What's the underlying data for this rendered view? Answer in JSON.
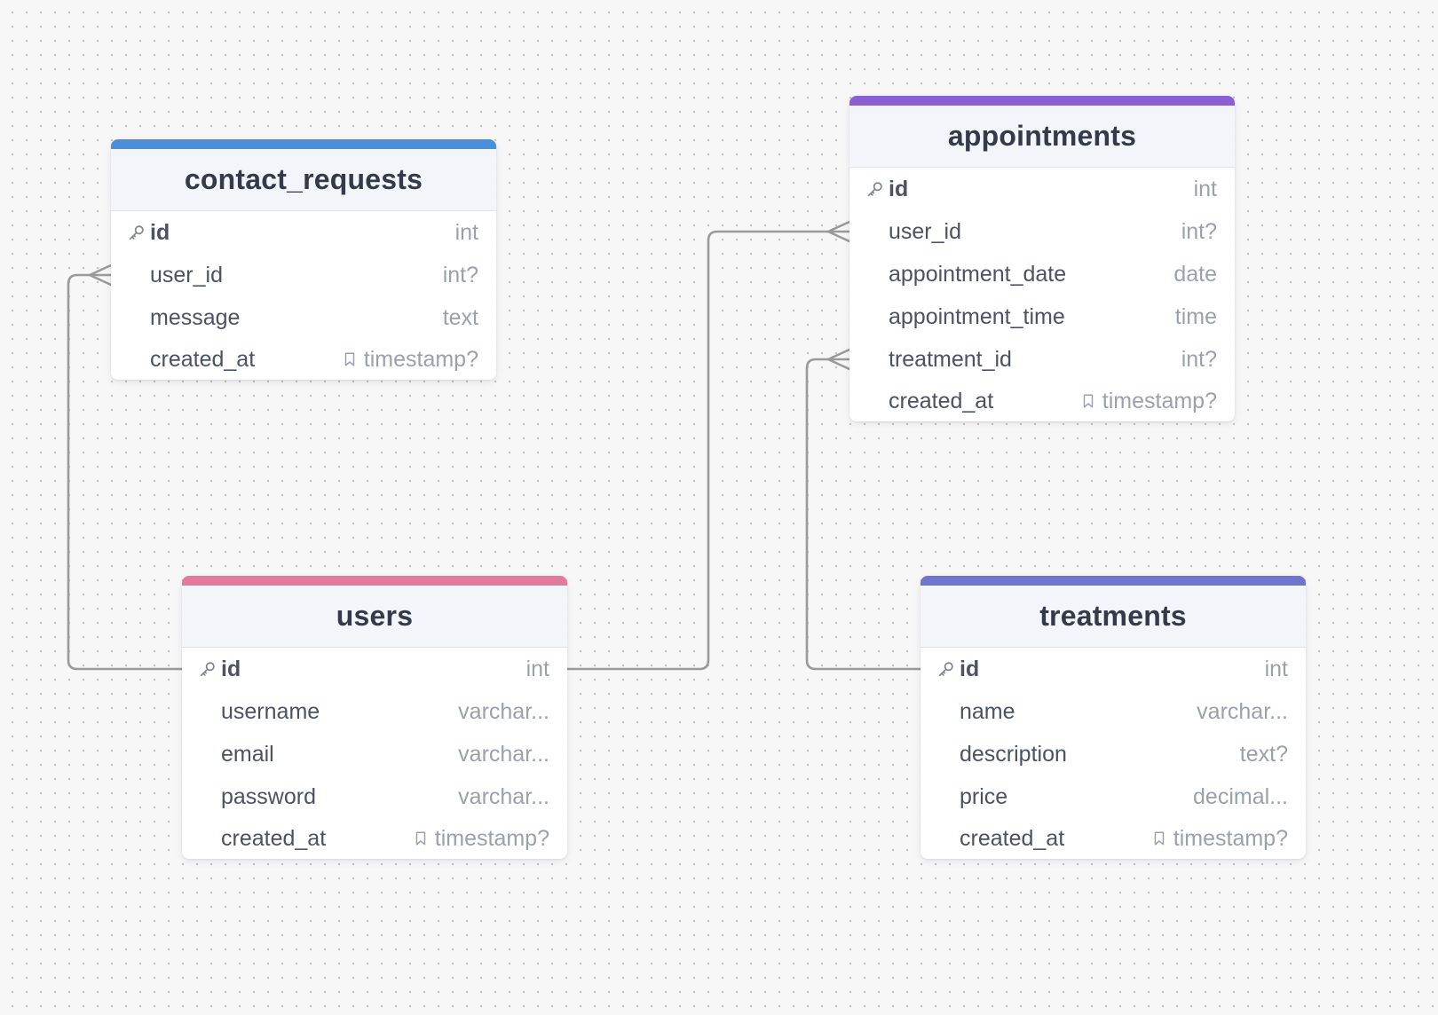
{
  "tables": {
    "contact_requests": {
      "name": "contact_requests",
      "accent": "#4a8fdc",
      "columns": [
        {
          "name": "id",
          "type": "int",
          "pk": true,
          "type_icon": ""
        },
        {
          "name": "user_id",
          "type": "int?",
          "pk": false,
          "type_icon": ""
        },
        {
          "name": "message",
          "type": "text",
          "pk": false,
          "type_icon": ""
        },
        {
          "name": "created_at",
          "type": "timestamp?",
          "pk": false,
          "type_icon": "bookmark-icon"
        }
      ]
    },
    "appointments": {
      "name": "appointments",
      "accent": "#8a5fd6",
      "columns": [
        {
          "name": "id",
          "type": "int",
          "pk": true,
          "type_icon": ""
        },
        {
          "name": "user_id",
          "type": "int?",
          "pk": false,
          "type_icon": ""
        },
        {
          "name": "appointment_date",
          "type": "date",
          "pk": false,
          "type_icon": ""
        },
        {
          "name": "appointment_time",
          "type": "time",
          "pk": false,
          "type_icon": ""
        },
        {
          "name": "treatment_id",
          "type": "int?",
          "pk": false,
          "type_icon": ""
        },
        {
          "name": "created_at",
          "type": "timestamp?",
          "pk": false,
          "type_icon": "bookmark-icon"
        }
      ]
    },
    "users": {
      "name": "users",
      "accent": "#e3799d",
      "columns": [
        {
          "name": "id",
          "type": "int",
          "pk": true,
          "type_icon": ""
        },
        {
          "name": "username",
          "type": "varchar...",
          "pk": false,
          "type_icon": ""
        },
        {
          "name": "email",
          "type": "varchar...",
          "pk": false,
          "type_icon": ""
        },
        {
          "name": "password",
          "type": "varchar...",
          "pk": false,
          "type_icon": ""
        },
        {
          "name": "created_at",
          "type": "timestamp?",
          "pk": false,
          "type_icon": "bookmark-icon"
        }
      ]
    },
    "treatments": {
      "name": "treatments",
      "accent": "#6f74cc",
      "columns": [
        {
          "name": "id",
          "type": "int",
          "pk": true,
          "type_icon": ""
        },
        {
          "name": "name",
          "type": "varchar...",
          "pk": false,
          "type_icon": ""
        },
        {
          "name": "description",
          "type": "text?",
          "pk": false,
          "type_icon": ""
        },
        {
          "name": "price",
          "type": "decimal...",
          "pk": false,
          "type_icon": ""
        },
        {
          "name": "created_at",
          "type": "timestamp?",
          "pk": false,
          "type_icon": "bookmark-icon"
        }
      ]
    }
  },
  "relationships": [
    {
      "from_table": "users",
      "from_column": "id",
      "to_table": "contact_requests",
      "to_column": "user_id",
      "cardinality": "one-to-many"
    },
    {
      "from_table": "users",
      "from_column": "id",
      "to_table": "appointments",
      "to_column": "user_id",
      "cardinality": "one-to-many"
    },
    {
      "from_table": "treatments",
      "from_column": "id",
      "to_table": "appointments",
      "to_column": "treatment_id",
      "cardinality": "one-to-many"
    }
  ],
  "icons": {
    "primary_key": "key-icon",
    "nullable_default": "bookmark-icon"
  },
  "colors": {
    "edge": "#9a9a9a",
    "header_bg": "#f2f5fa",
    "column_text": "#4b5263",
    "type_text": "#9aa1ad"
  }
}
